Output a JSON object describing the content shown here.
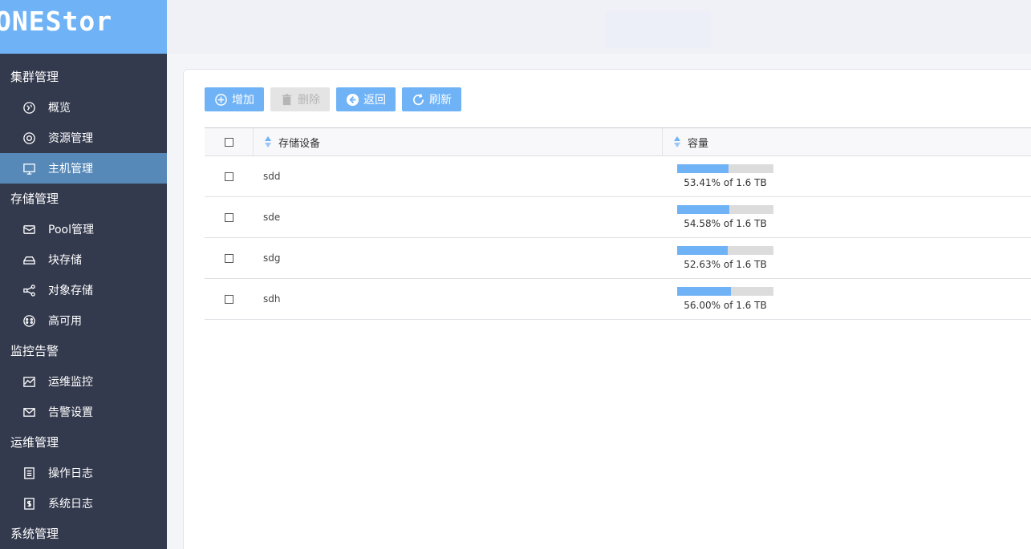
{
  "app": {
    "logo": "ONEStor"
  },
  "sidebar": {
    "groups": [
      {
        "label": "集群管理",
        "items": [
          {
            "label": "概览",
            "icon": "globe-icon"
          },
          {
            "label": "资源管理",
            "icon": "lifebuoy-icon"
          },
          {
            "label": "主机管理",
            "icon": "monitor-icon",
            "active": true
          }
        ]
      },
      {
        "label": "存储管理",
        "items": [
          {
            "label": "Pool管理",
            "icon": "inbox-icon"
          },
          {
            "label": "块存储",
            "icon": "drive-icon"
          },
          {
            "label": "对象存储",
            "icon": "share-icon"
          },
          {
            "label": "高可用",
            "icon": "ha-icon"
          }
        ]
      },
      {
        "label": "监控告警",
        "items": [
          {
            "label": "运维监控",
            "icon": "chart-icon"
          },
          {
            "label": "告警设置",
            "icon": "mail-icon"
          }
        ]
      },
      {
        "label": "运维管理",
        "items": [
          {
            "label": "操作日志",
            "icon": "doc-icon"
          },
          {
            "label": "系统日志",
            "icon": "dollar-doc-icon"
          }
        ]
      },
      {
        "label": "系统管理",
        "items": []
      }
    ]
  },
  "toolbar": {
    "add_label": "增加",
    "delete_label": "删除",
    "back_label": "返回",
    "refresh_label": "刷新"
  },
  "table": {
    "headers": {
      "device": "存储设备",
      "capacity": "容量"
    },
    "rows": [
      {
        "device": "sdd",
        "used_pct": 53.41,
        "capacity_text": "53.41% of 1.6 TB"
      },
      {
        "device": "sde",
        "used_pct": 54.58,
        "capacity_text": "54.58% of 1.6 TB"
      },
      {
        "device": "sdg",
        "used_pct": 52.63,
        "capacity_text": "52.63% of 1.6 TB"
      },
      {
        "device": "sdh",
        "used_pct": 56.0,
        "capacity_text": "56.00% of 1.6 TB"
      }
    ]
  },
  "colors": {
    "accent": "#6fb3f6",
    "sidebar_bg": "#343a4e",
    "sidebar_active": "#5789b8"
  }
}
